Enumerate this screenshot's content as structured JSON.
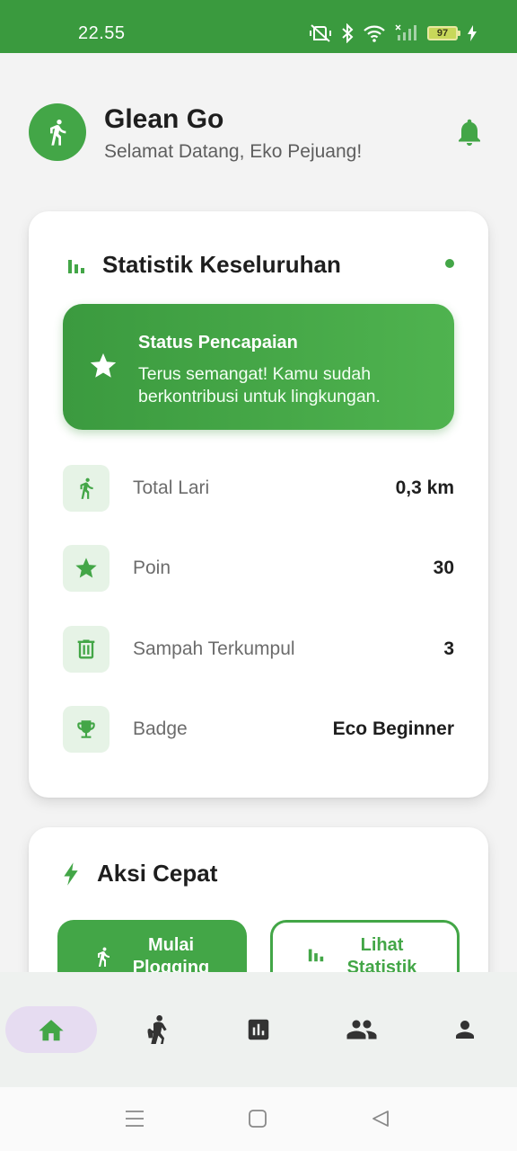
{
  "status_bar": {
    "time": "22.55",
    "battery": "97",
    "icons": [
      "mute-vibrate-icon",
      "bluetooth-icon",
      "wifi-icon",
      "signal-icon",
      "battery-icon",
      "charging-icon"
    ]
  },
  "header": {
    "app_name": "Glean Go",
    "welcome": "Selamat Datang, Eko Pejuang!",
    "logo_icon": "runner-icon",
    "notification_icon": "bell-icon"
  },
  "stats_card": {
    "title": "Statistik Keseluruhan",
    "banner": {
      "title": "Status Pencapaian",
      "text": "Terus semangat! Kamu sudah berkontribusi untuk lingkungan."
    },
    "rows": [
      {
        "label": "Total Lari",
        "value": "0,3 km",
        "icon": "runner-icon"
      },
      {
        "label": "Poin",
        "value": "30",
        "icon": "star-icon"
      },
      {
        "label": "Sampah Terkumpul",
        "value": "3",
        "icon": "trash-icon"
      },
      {
        "label": "Badge",
        "value": "Eco Beginner",
        "icon": "trophy-icon"
      }
    ]
  },
  "actions_card": {
    "title": "Aksi Cepat",
    "primary_button": "Mulai Plogging",
    "secondary_button": "Lihat Statistik"
  },
  "bottom_nav": {
    "items": [
      "home-icon",
      "plogging-icon",
      "stats-icon",
      "community-icon",
      "profile-icon"
    ],
    "active": "home-icon"
  },
  "colors": {
    "primary": "#43a647",
    "status_bar": "#3a9a3e",
    "active_nav_bg": "#e6dcf1"
  }
}
